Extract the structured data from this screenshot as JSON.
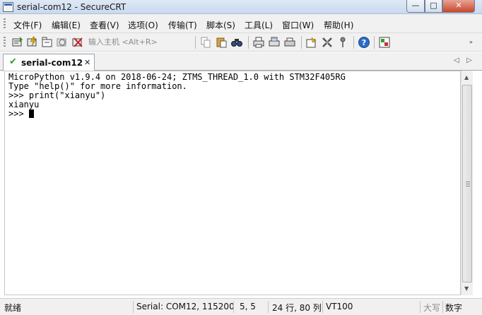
{
  "window": {
    "title": "serial-com12 - SecureCRT",
    "minimize_glyph": "—",
    "maximize_glyph": "□",
    "close_glyph": "✕"
  },
  "menu": {
    "items": [
      {
        "label": "文件(F)"
      },
      {
        "label": "编辑(E)"
      },
      {
        "label": "查看(V)"
      },
      {
        "label": "选项(O)"
      },
      {
        "label": "传输(T)"
      },
      {
        "label": "脚本(S)"
      },
      {
        "label": "工具(L)"
      },
      {
        "label": "窗口(W)"
      },
      {
        "label": "帮助(H)"
      }
    ]
  },
  "toolbar": {
    "host_placeholder": "输入主机 <Alt+R>",
    "overflow_glyph": "»",
    "icons": [
      "connect-icon",
      "quick-connect-icon",
      "connect-tab-icon",
      "reconnect-icon",
      "disconnect-icon",
      "copy-icon",
      "paste-icon",
      "find-icon",
      "print-setup-icon",
      "print-icon",
      "print-screen-icon",
      "session-options-icon",
      "global-options-icon",
      "keymap-icon",
      "help-icon",
      "sftp-icon"
    ]
  },
  "tabs": {
    "active": {
      "label": "serial-com12",
      "status_glyph": "✔",
      "close_glyph": "✕"
    },
    "nav_left": "◁",
    "nav_right": "▷"
  },
  "terminal": {
    "lines": [
      "MicroPython v1.9.4 on 2018-06-24; ZTMS_THREAD_1.0 with STM32F405RG",
      "Type \"help()\" for more information.",
      ">>> print(\"xianyu\")",
      "xianyu",
      ">>> "
    ]
  },
  "scrollbar": {
    "up_glyph": "▲",
    "down_glyph": "▼"
  },
  "status": {
    "ready": "就绪",
    "connection": "Serial: COM12, 115200",
    "cursor_pos": "5,   5",
    "size": "24 行, 80 列",
    "emulation": "VT100",
    "caps": "大写",
    "num": "数字"
  },
  "colors": {
    "terminal_bg": "#ffffff",
    "terminal_fg": "#000000",
    "tab_check": "#2f9e2f",
    "close_button": "#c9462c"
  }
}
